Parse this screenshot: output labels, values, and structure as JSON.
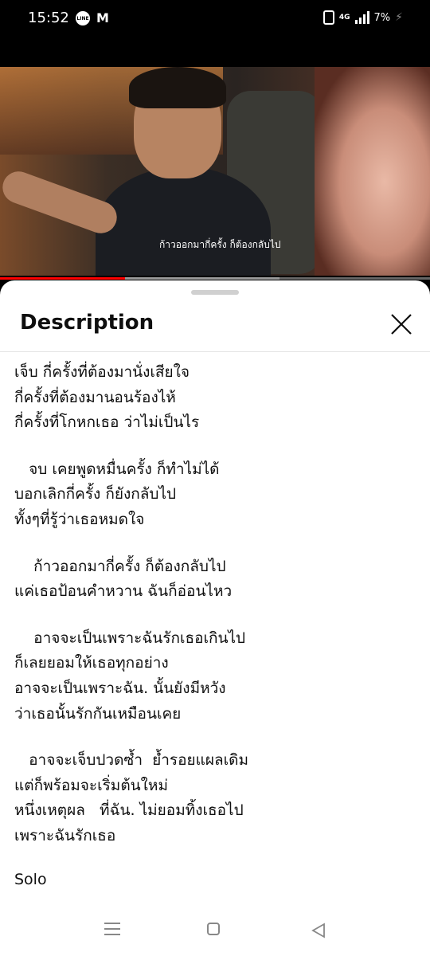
{
  "status_bar": {
    "time": "15:52",
    "line_icon": "LINE",
    "mail_icon": "M",
    "network": "4G",
    "battery": "7%",
    "icons": [
      "line-app-icon",
      "gmail-icon",
      "vibrate-icon",
      "signal-icon",
      "battery-bolt-icon"
    ]
  },
  "video": {
    "subtitle": "ก้าวออกมากี่ครั้ง  ก็ต้องกลับไป",
    "progress_played": 0.29,
    "progress_buffered": 0.65,
    "colors": {
      "played": "#ff0000",
      "buffered": "#999999",
      "track": "#666666"
    }
  },
  "panel": {
    "title": "Description",
    "close_icon": "close-icon"
  },
  "description": [
    [
      "เจ็บ กี่ครั้งที่ต้องมานั่งเสียใจ",
      "กี่ครั้งที่ต้องมานอนร้องไห้",
      "กี่ครั้งที่โกหกเธอ ว่าไม่เป็นไร"
    ],
    [
      "   จบ เคยพูดหมื่นครั้ง ก็ทำไม่ได้",
      "บอกเลิกกี่ครั้ง ก็ยังกลับไป",
      "ทั้งๆที่รู้ว่าเธอหมดใจ"
    ],
    [
      "    ก้าวออกมากี่ครั้ง ก็ต้องกลับไป",
      "แค่เธอป้อนคำหวาน ฉันก็อ่อนไหว"
    ],
    [
      "    อาจจะเป็นเพราะฉันรักเธอเกินไป",
      "ก็เลยยอมให้เธอทุกอย่าง",
      "อาจจะเป็นเพราะฉัน. นั้นยังมีหวัง",
      "ว่าเธอนั้นรักกันเหมือนเคย"
    ],
    [
      "   อาจจะเจ็บปวดซ้ำ  ย้ำรอยแผลเดิม",
      "แต่ก็พร้อมจะเริ่มต้นใหม่",
      "หนึ่งเหตุผล   ที่ฉัน. ไม่ยอมทิ้งเธอไป",
      "เพราะฉันรักเธอ"
    ],
    [
      "Solo"
    ]
  ],
  "nav_bar": {
    "icons": [
      "recent-apps-icon",
      "home-icon",
      "back-icon"
    ]
  }
}
